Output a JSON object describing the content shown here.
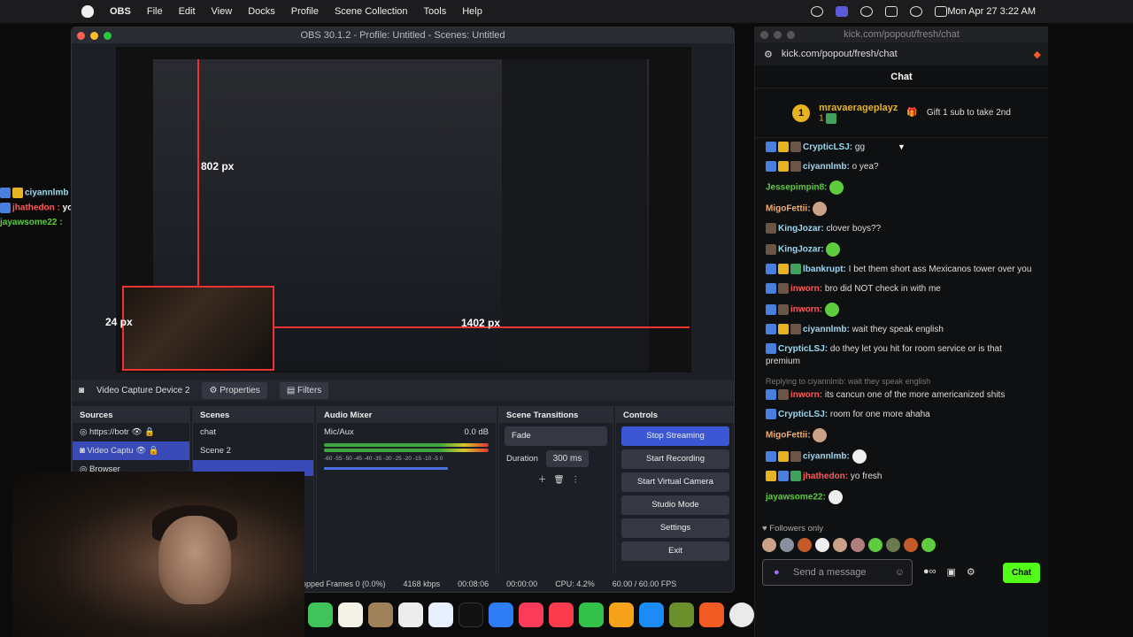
{
  "menubar": {
    "app": "OBS",
    "items": [
      "File",
      "Edit",
      "View",
      "Docks",
      "Profile",
      "Scene Collection",
      "Tools",
      "Help"
    ],
    "clock": "Mon Apr 27  3:22 AM"
  },
  "obs": {
    "title": "OBS 30.1.2 - Profile: Untitled - Scenes: Untitled",
    "preview_labels": {
      "w1": "802 px",
      "h1": "24 px",
      "w2": "1402 px",
      "h2": "24 px"
    },
    "source_bar": {
      "source": "Video Capture Device 2",
      "properties": "Properties",
      "filters": "Filters"
    },
    "docks": {
      "sources": {
        "title": "Sources",
        "items": [
          "https://botr",
          "Video Captu",
          "Browser"
        ]
      },
      "scenes": {
        "title": "Scenes",
        "items": [
          "chat",
          "Scene 2"
        ]
      },
      "mixer": {
        "title": "Audio Mixer",
        "track": "Mic/Aux",
        "db": "0.0 dB",
        "scale": "-60  -55  -50  -45  -40  -35  -30  -25  -20  -15  -10  -5  0"
      },
      "transitions": {
        "title": "Scene Transitions",
        "type": "Fade",
        "duration_label": "Duration",
        "duration": "300 ms"
      },
      "controls": {
        "title": "Controls",
        "buttons": [
          "Stop Streaming",
          "Start Recording",
          "Start Virtual Camera",
          "Studio Mode",
          "Settings",
          "Exit"
        ]
      }
    },
    "status": {
      "dropped": "opped Frames 0 (0.0%)",
      "kbps": "4168 kbps",
      "stream_time": "00:08:06",
      "rec_time": "00:00:00",
      "cpu": "CPU: 4.2%",
      "fps": "60.00 / 60.00 FPS"
    }
  },
  "overlay_chat": [
    {
      "user": "ciyannlmb :",
      "color": "#9ad8f0"
    },
    {
      "user": "jhathedon :",
      "text": " yo fresh",
      "color": "#ff5a5a"
    },
    {
      "user": "jayawsome22 :",
      "color": "#5dcc3f"
    }
  ],
  "kick": {
    "window_title": "kick.com/popout/fresh/chat",
    "url": "kick.com/popout/fresh/chat",
    "header": "Chat",
    "pinned": {
      "rank": "1",
      "user": "mravaerageplayz",
      "count": "1",
      "text": "Gift 1 sub to take 2nd"
    },
    "messages": [
      {
        "user": "CrypticLSJ:",
        "text": " gg",
        "color": "#9ad8f0"
      },
      {
        "user": "ciyannlmb:",
        "text": " o yea?",
        "color": "#9ad8f0"
      },
      {
        "user": "Jessepimpin8:",
        "text": "",
        "color": "#5dcc3f"
      },
      {
        "user": "MigoFettii:",
        "text": "",
        "color": "#f0b070"
      },
      {
        "user": "KingJozar:",
        "text": " clover boys??",
        "color": "#9ad8f0"
      },
      {
        "user": "KingJozar:",
        "text": "",
        "color": "#9ad8f0"
      },
      {
        "user": "lbankrupt:",
        "text": " I bet them short ass Mexicanos tower over you",
        "color": "#9ad8f0"
      },
      {
        "user": "inworn:",
        "text": " bro did NOT check in with me",
        "color": "#ff5a5a"
      },
      {
        "user": "inworn:",
        "text": "",
        "color": "#ff5a5a"
      },
      {
        "user": "ciyannlmb:",
        "text": " wait they speak english",
        "color": "#9ad8f0"
      },
      {
        "user": "CrypticLSJ:",
        "text": " do they let you hit for room service or is that premium",
        "color": "#9ad8f0"
      },
      {
        "reply": "Replying to ciyannlmb: wait they speak english",
        "user": "inworn:",
        "text": " its cancun one of the more americanized shits",
        "color": "#ff5a5a"
      },
      {
        "user": "CrypticLSJ:",
        "text": " room for one more ahaha",
        "color": "#9ad8f0"
      },
      {
        "user": "MigoFettii:",
        "text": "",
        "color": "#f0b070"
      },
      {
        "user": "ciyannlmb:",
        "text": "",
        "color": "#9ad8f0"
      },
      {
        "user": "jhathedon:",
        "text": " yo fresh",
        "color": "#ff5a5a"
      },
      {
        "user": "jayawsome22:",
        "text": "",
        "color": "#5dcc3f"
      }
    ],
    "followers_only": "Followers only",
    "input_placeholder": "Send a message",
    "chat_button": "Chat"
  }
}
